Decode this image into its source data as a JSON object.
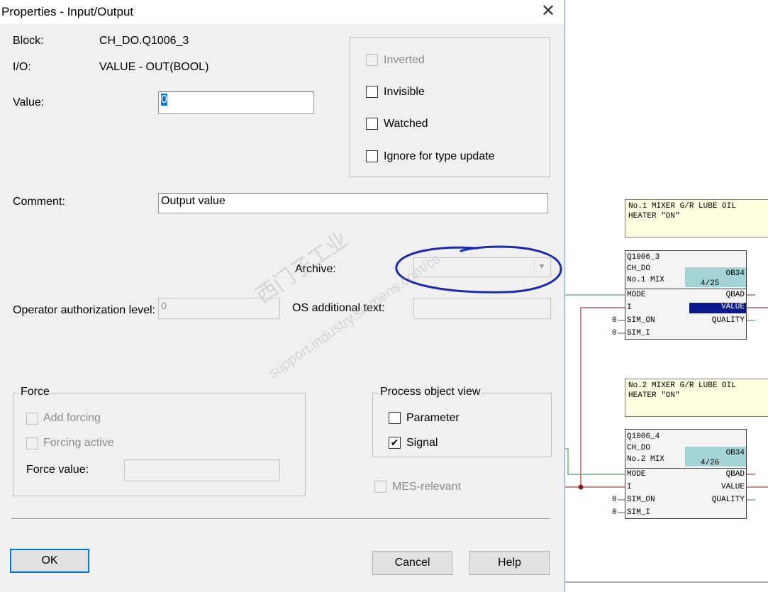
{
  "dialog": {
    "title": "Properties - Input/Output",
    "close_glyph": "✕",
    "block_label": "Block:",
    "block_value": "CH_DO.Q1006_3",
    "io_label": "I/O:",
    "io_value": "VALUE  -  OUT(BOOL)",
    "value_label": "Value:",
    "value_input": "0",
    "comment_label": "Comment:",
    "comment_input": "Output value",
    "archive_label": "Archive:",
    "archive_value": "",
    "operator_auth_label": "Operator authorization level:",
    "operator_auth_value": "0",
    "os_text_label": "OS additional text:",
    "os_text_value": ""
  },
  "options": {
    "inverted": {
      "label": "Inverted",
      "checked": false,
      "enabled": false
    },
    "invisible": {
      "label": "Invisible",
      "checked": false,
      "enabled": true
    },
    "watched": {
      "label": "Watched",
      "checked": false,
      "enabled": true
    },
    "ignore_type_update": {
      "label": "Ignore for type update",
      "checked": false,
      "enabled": true
    }
  },
  "force": {
    "legend": "Force",
    "add_forcing": "Add forcing",
    "forcing_active": "Forcing active",
    "force_value_label": "Force value:",
    "force_value": ""
  },
  "process_object_view": {
    "legend": "Process object view",
    "parameter": {
      "label": "Parameter",
      "checked": false
    },
    "signal": {
      "label": "Signal",
      "checked": true
    }
  },
  "mes_relevant": {
    "label": "MES-relevant",
    "checked": false,
    "enabled": false
  },
  "buttons": {
    "ok": "OK",
    "cancel": "Cancel",
    "help": "Help"
  },
  "check_glyph": "✔",
  "watermark": {
    "line1": "西门子工业",
    "line2": "support.industry.siemens.com/cs"
  },
  "colors": {
    "selection": "#0078d7",
    "annotation": "#1a2bb0",
    "wire_green": "#2e8b3a",
    "wire_red": "#8b1a1a",
    "teal": "#a4d4d6"
  },
  "cfc": {
    "note1": {
      "line1": "No.1 MIXER G/R LUBE OIL",
      "line2": "HEATER \"ON\""
    },
    "block1": {
      "name": "Q1006_3",
      "type": "CH_DO",
      "comment": "No.1 MIX",
      "ob": "OB34",
      "seq": "4/25",
      "inputs": [
        "MODE",
        "I",
        "SIM_ON",
        "SIM_I"
      ],
      "outputs": [
        "QBAD",
        "VALUE",
        "QUALITY"
      ],
      "sim_on_val": "0",
      "sim_i_val": "0"
    },
    "note2": {
      "line1": "No.2 MIXER G/R LUBE OIL",
      "line2": "HEATER \"ON\""
    },
    "block2": {
      "name": "Q1006_4",
      "type": "CH_DO",
      "comment": "No.2 MIX",
      "ob": "OB34",
      "seq": "4/26",
      "inputs": [
        "MODE",
        "I",
        "SIM_ON",
        "SIM_I"
      ],
      "outputs": [
        "QBAD",
        "VALUE",
        "QUALITY"
      ],
      "sim_on_val": "0",
      "sim_i_val": "0"
    }
  }
}
